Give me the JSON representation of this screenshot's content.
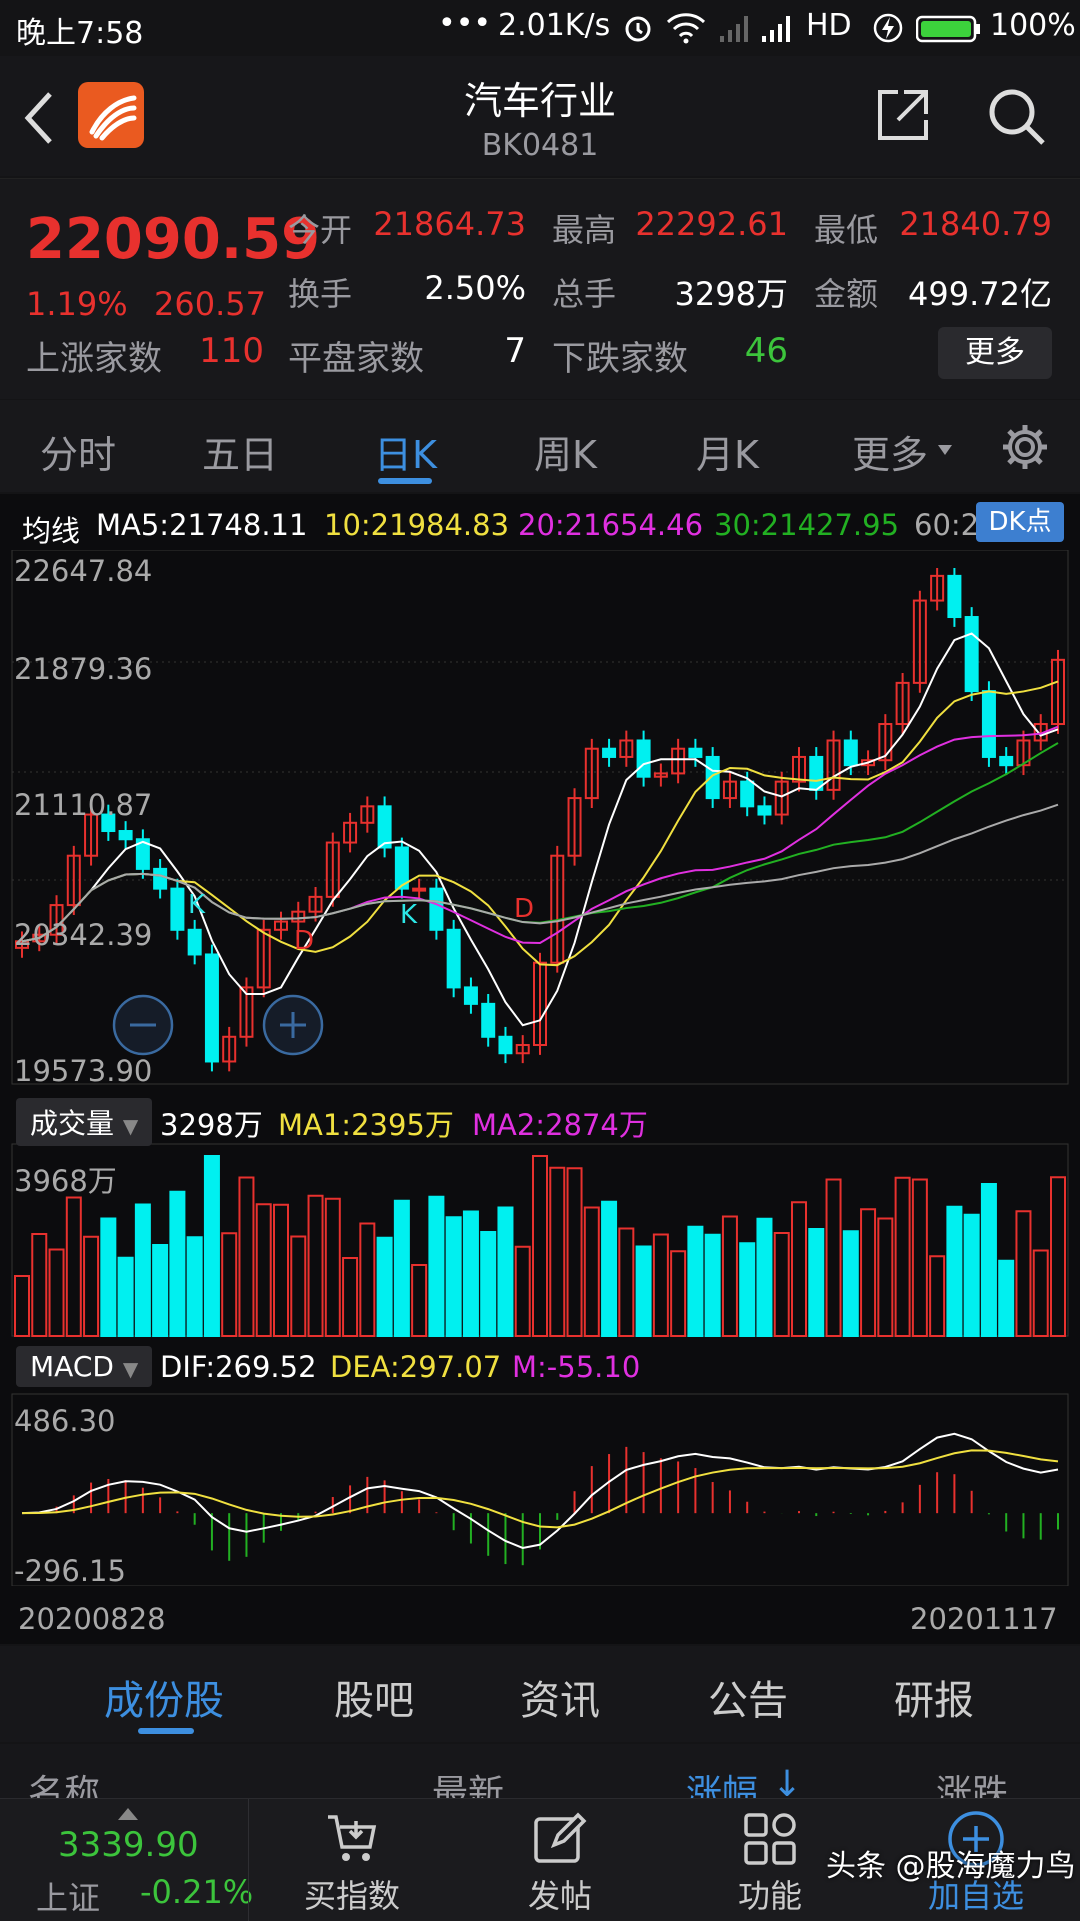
{
  "status": {
    "time": "晚上7:58",
    "dots": "•••",
    "speed": "2.01K/s",
    "network": "HD",
    "battery": "100%"
  },
  "header": {
    "title": "汽车行业",
    "code": "BK0481"
  },
  "quote": {
    "price": "22090.59",
    "change_pct": "1.19%",
    "change": "260.57",
    "open_label": "今开",
    "open": "21864.73",
    "high_label": "最高",
    "high": "22292.61",
    "low_label": "最低",
    "low": "21840.79",
    "turnover_label": "换手",
    "turnover": "2.50%",
    "volume_label": "总手",
    "volume": "3298万",
    "amount_label": "金额",
    "amount": "499.72亿",
    "up_label": "上涨家数",
    "up": "110",
    "flat_label": "平盘家数",
    "flat": "7",
    "down_label": "下跌家数",
    "down": "46",
    "more_label": "更多"
  },
  "tabs": {
    "t1": "分时",
    "t2": "五日",
    "t3": "日K",
    "t4": "周K",
    "t5": "月K",
    "t6": "更多"
  },
  "ma_legend": {
    "label": "均线",
    "ma5": "MA5:21748.11",
    "ma10": "10:21984.83",
    "ma20": "20:21654.46",
    "ma30": "30:21427.95",
    "ma60": "60:2",
    "dk": "DK点"
  },
  "axis": {
    "y1": "22647.84",
    "y2": "21879.36",
    "y3": "21110.87",
    "y4": "20342.39",
    "y5": "19573.90",
    "vol_max": "3968万",
    "macd_max": "486.30",
    "macd_min": "-296.15",
    "date_start": "20200828",
    "date_end": "20201117"
  },
  "marks": {
    "k1": "K",
    "k2": "K",
    "d1": "D",
    "d2": "D"
  },
  "volume_legend": {
    "label": "成交量",
    "value": "3298万",
    "ma1": "MA1:2395万",
    "ma2": "MA2:2874万"
  },
  "macd_legend": {
    "label": "MACD",
    "dif": "DIF:269.52",
    "dea": "DEA:297.07",
    "m": "M:-55.10"
  },
  "bottom_tabs": {
    "b1": "成份股",
    "b2": "股吧",
    "b3": "资讯",
    "b4": "公告",
    "b5": "研报"
  },
  "table_head": {
    "name": "名称",
    "latest": "最新",
    "pct": "涨幅",
    "chg": "涨跌"
  },
  "bottom_bar": {
    "index_value": "3339.90",
    "index_name": "上证",
    "index_change": "-0.21%",
    "buy": "买指数",
    "post": "发帖",
    "func": "功能",
    "add": "加自选"
  },
  "watermark": "头条 @股海魔力鸟",
  "colors": {
    "up": "#e8312e",
    "down": "#00f0f0",
    "accent": "#3d8fe0",
    "ma5": "#ffffff",
    "ma10": "#f0e040",
    "ma20": "#e030e0",
    "ma30": "#22b022",
    "ma60": "#aaaaaa"
  },
  "chart_data": {
    "type": "candlestick",
    "x_range": [
      "20200828",
      "20201117"
    ],
    "ylim": [
      19573.9,
      22647.84
    ],
    "closes": [
      20380,
      20420,
      20600,
      20900,
      21150,
      21050,
      21000,
      20820,
      20700,
      20450,
      20300,
      19650,
      19800,
      20100,
      20450,
      20500,
      20560,
      20650,
      20980,
      21100,
      21200,
      20950,
      20700,
      20700,
      20450,
      20100,
      20000,
      19800,
      19700,
      19750,
      20250,
      20900,
      21250,
      21550,
      21500,
      21600,
      21380,
      21400,
      21550,
      21500,
      21250,
      21350,
      21200,
      21150,
      21350,
      21500,
      21300,
      21600,
      21450,
      21480,
      21700,
      21950,
      22450,
      22600,
      22350,
      21900,
      21500,
      21450,
      21600,
      21700,
      22090
    ],
    "volume_ma_note": "3298万",
    "macd": {
      "dif": 269.52,
      "dea": 297.07,
      "m": -55.1,
      "ylim": [
        -296.15,
        486.3
      ]
    }
  }
}
